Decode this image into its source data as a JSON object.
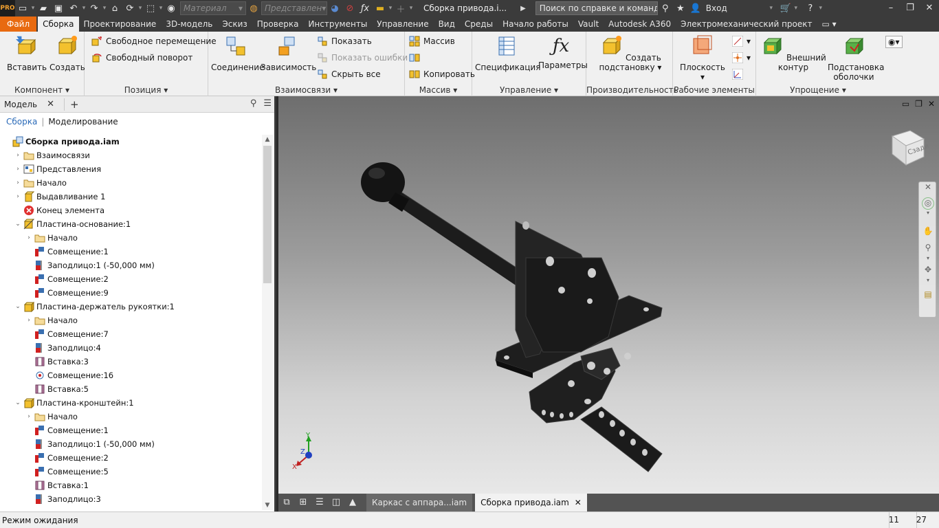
{
  "qat": {
    "material_placeholder": "Материал",
    "appearance_placeholder": "Представлен",
    "window_title": "Сборка привода.i...",
    "search_text": "Поиск по справке и командам...",
    "login_label": "Вход"
  },
  "tabs": [
    "Файл",
    "Сборка",
    "Проектирование",
    "3D-модель",
    "Эскиз",
    "Проверка",
    "Инструменты",
    "Управление",
    "Вид",
    "Среды",
    "Начало работы",
    "Vault",
    "Autodesk A360",
    "Электромеханический проект"
  ],
  "active_tab": "Сборка",
  "ribbon": {
    "component": {
      "label": "Компонент",
      "insert": "Вставить",
      "create": "Создать"
    },
    "position": {
      "label": "Позиция",
      "free_move": "Свободное перемещение",
      "free_rotate": "Свободный поворот"
    },
    "relationships": {
      "label": "Взаимосвязи",
      "joint": "Соединение",
      "constraint": "Зависимость",
      "show": "Показать",
      "show_errors": "Показать ошибки",
      "hide_all": "Скрыть все"
    },
    "pattern": {
      "label": "Массив",
      "pattern": "Массив",
      "copy": "Копировать"
    },
    "manage": {
      "label": "Управление",
      "bom": "Спецификация",
      "params": "Параметры"
    },
    "productivity": {
      "label": "Производительность",
      "create_sub": "Создать",
      "create_sub2": "подстановку"
    },
    "work_features": {
      "label": "Рабочие элементы",
      "plane": "Плоскость"
    },
    "simplification": {
      "label": "Упрощение",
      "shrinkwrap": "Внешний контур",
      "shrinkwrap_sub": "Подстановка",
      "shrinkwrap_sub2": "оболочки"
    }
  },
  "browser": {
    "title": "Модель",
    "sub_assembly": "Сборка",
    "sub_modeling": "Моделирование",
    "tree": [
      {
        "label": "Сборка привода.iam",
        "level": 0,
        "expand": "",
        "icon": "assembly-icon",
        "bold": true
      },
      {
        "label": "Взаимосвязи",
        "level": 1,
        "expand": ">",
        "icon": "folder-icon"
      },
      {
        "label": "Представления",
        "level": 1,
        "expand": ">",
        "icon": "representations-icon"
      },
      {
        "label": "Начало",
        "level": 1,
        "expand": ">",
        "icon": "folder-icon"
      },
      {
        "label": "Выдавливание 1",
        "level": 1,
        "expand": ">",
        "icon": "extrude-icon"
      },
      {
        "label": "Конец элемента",
        "level": 1,
        "expand": "",
        "icon": "end-of-part-icon"
      },
      {
        "label": "Пластина-основание:1",
        "level": 1,
        "expand": "v",
        "icon": "grounded-part-icon"
      },
      {
        "label": "Начало",
        "level": 2,
        "expand": ">",
        "icon": "folder-icon"
      },
      {
        "label": "Совмещение:1",
        "level": 2,
        "expand": "",
        "icon": "mate-icon"
      },
      {
        "label": "Заподлицо:1 (-50,000 мм)",
        "level": 2,
        "expand": "",
        "icon": "flush-icon"
      },
      {
        "label": "Совмещение:2",
        "level": 2,
        "expand": "",
        "icon": "mate-icon"
      },
      {
        "label": "Совмещение:9",
        "level": 2,
        "expand": "",
        "icon": "mate-icon"
      },
      {
        "label": "Пластина-держатель рукоятки:1",
        "level": 1,
        "expand": "v",
        "icon": "part-icon"
      },
      {
        "label": "Начало",
        "level": 2,
        "expand": ">",
        "icon": "folder-icon"
      },
      {
        "label": "Совмещение:7",
        "level": 2,
        "expand": "",
        "icon": "mate-icon"
      },
      {
        "label": "Заподлицо:4",
        "level": 2,
        "expand": "",
        "icon": "flush-icon"
      },
      {
        "label": "Вставка:3",
        "level": 2,
        "expand": "",
        "icon": "insert-icon"
      },
      {
        "label": "Совмещение:16",
        "level": 2,
        "expand": "",
        "icon": "tangent-icon"
      },
      {
        "label": "Вставка:5",
        "level": 2,
        "expand": "",
        "icon": "insert-icon"
      },
      {
        "label": "Пластина-кронштейн:1",
        "level": 1,
        "expand": "v",
        "icon": "part-icon"
      },
      {
        "label": "Начало",
        "level": 2,
        "expand": ">",
        "icon": "folder-icon"
      },
      {
        "label": "Совмещение:1",
        "level": 2,
        "expand": "",
        "icon": "mate-icon"
      },
      {
        "label": "Заподлицо:1 (-50,000 мм)",
        "level": 2,
        "expand": "",
        "icon": "flush-icon"
      },
      {
        "label": "Совмещение:2",
        "level": 2,
        "expand": "",
        "icon": "mate-icon"
      },
      {
        "label": "Совмещение:5",
        "level": 2,
        "expand": "",
        "icon": "mate-icon"
      },
      {
        "label": "Вставка:1",
        "level": 2,
        "expand": "",
        "icon": "insert-icon"
      },
      {
        "label": "Заподлицо:3",
        "level": 2,
        "expand": "",
        "icon": "flush-icon"
      }
    ]
  },
  "viewcube_label": "Сзади",
  "triad": {
    "x": "X",
    "y": "Y",
    "z": "Z"
  },
  "doc_tabs": [
    {
      "label": "Каркас с аппара...iam",
      "active": false
    },
    {
      "label": "Сборка привода.iam",
      "active": true
    }
  ],
  "status": {
    "text": "Режим ожидания",
    "num1": "11",
    "num2": "27"
  },
  "colors": {
    "accent_file": "#e86a10",
    "title_bar": "#3b3b3b",
    "link": "#2a6ab8"
  }
}
